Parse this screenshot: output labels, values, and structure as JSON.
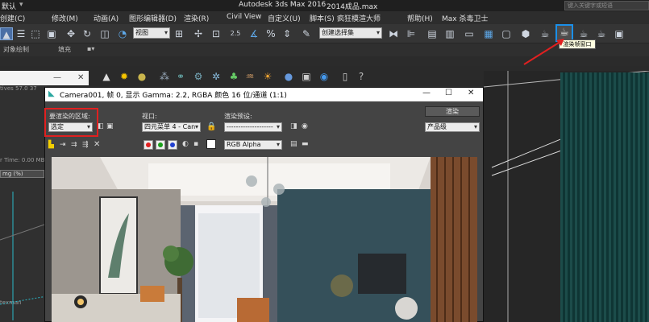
{
  "titlebar": {
    "left_label": "默认",
    "app_title": "Autodesk 3ds Max 2016",
    "file_name": "2014成品.max",
    "search_placeholder": "键入关键字或短语"
  },
  "menu": {
    "items": [
      "(C)",
      "修改(M)",
      "动画(A)",
      "图形编辑器(D)",
      "渲染(R)",
      "Civil View",
      "自定义(U)",
      "脚本(S)",
      "疯狂模渲大师",
      "帮助(H)",
      "Max 杀毒卫士"
    ],
    "first_partial": "创建(C)"
  },
  "toolbar": {
    "viewport_select": "视图",
    "named_selection": "创建选择集",
    "num_25": "2.5",
    "tooltip": "渲染帧窗口"
  },
  "strip": {
    "object_paint": "对象绘制",
    "populate": "填充"
  },
  "left_panel": {
    "t1": "tives 57.0 37",
    "t2": "r Time: 0.00 MB",
    "t3": "mg (%)",
    "t4": "texman"
  },
  "render_window": {
    "title": "Camera001, 帧 0, 显示 Gamma: 2.2, RGBA 颜色 16 位/通道 (1:1)",
    "area_label": "要渲染的区域:",
    "area_value": "选定",
    "viewport_label": "视口:",
    "viewport_value": "四元菜单 4 - Can",
    "preset_label": "渲染预设:",
    "preset_value": "--------------------",
    "render_button": "渲染",
    "quality_value": "产品级",
    "channel_value": "RGB Alpha"
  }
}
